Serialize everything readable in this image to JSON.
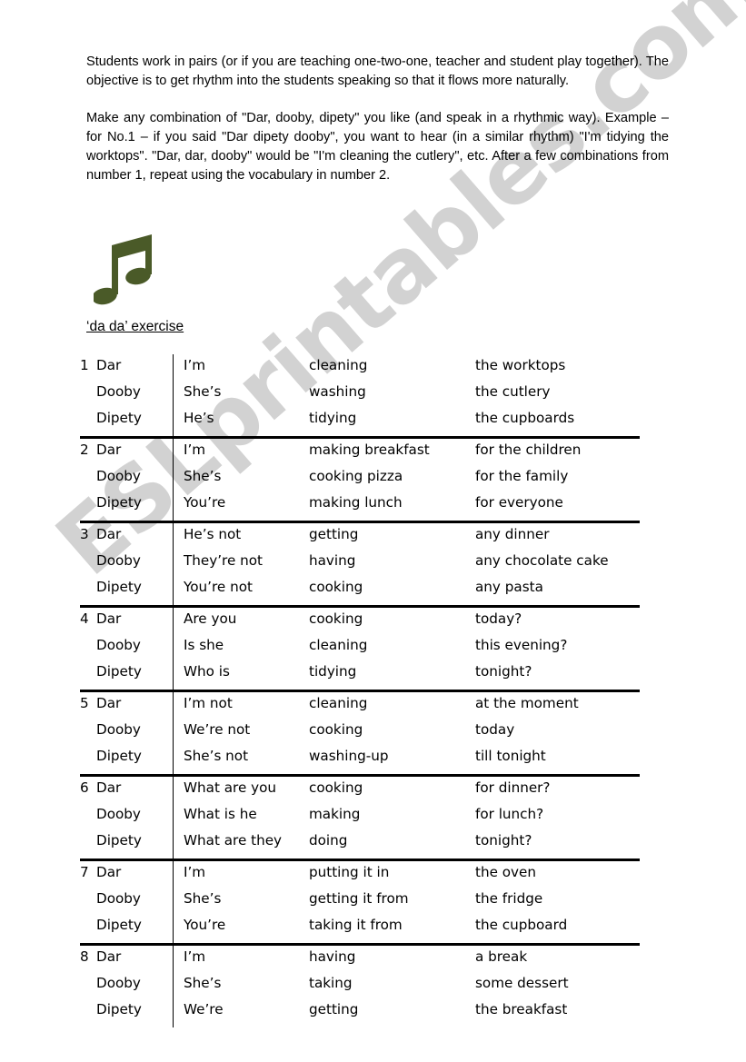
{
  "document": {
    "intro_paragraphs": [
      "Students work in pairs (or if you are teaching one-two-one, teacher and student play together).   The objective is to get rhythm into the students speaking so that it flows more naturally.",
      "Make any combination of \"Dar, dooby, dipety\" you like (and speak in a rhythmic way).  Example – for No.1 – if you said \"Dar dipety dooby\", you want to hear (in a similar rhythm) \"I'm tidying the worktops\".   \"Dar, dar, dooby\" would be \"I'm cleaning the cutlery\", etc.  After a few combinations from number 1, repeat using the vocabulary in number 2."
    ],
    "note_icon_color": "#4a5a28",
    "section_heading": "‘da da’ exercise",
    "watermark_text": "ESLprintables.com",
    "watermark_color": "#d2d2d2"
  },
  "table": {
    "groups": [
      {
        "number": "1",
        "lines": [
          {
            "syllable": "Dar",
            "subject": "I’m",
            "verb": "cleaning",
            "object": "the worktops"
          },
          {
            "syllable": "Dooby",
            "subject": "She’s",
            "verb": "washing",
            "object": "the cutlery"
          },
          {
            "syllable": "Dipety",
            "subject": "He’s",
            "verb": "tidying",
            "object": "the cupboards"
          }
        ]
      },
      {
        "number": "2",
        "lines": [
          {
            "syllable": "Dar",
            "subject": "I’m",
            "verb": "making breakfast",
            "object": "for the children"
          },
          {
            "syllable": "Dooby",
            "subject": "She’s",
            "verb": "cooking pizza",
            "object": "for the family"
          },
          {
            "syllable": "Dipety",
            "subject": "You’re",
            "verb": "making lunch",
            "object": "for everyone"
          }
        ]
      },
      {
        "number": "3",
        "lines": [
          {
            "syllable": "Dar",
            "subject": "He’s not",
            "verb": "getting",
            "object": "any dinner"
          },
          {
            "syllable": "Dooby",
            "subject": "They’re not",
            "verb": "having",
            "object": "any chocolate cake"
          },
          {
            "syllable": "Dipety",
            "subject": "You’re not",
            "verb": "cooking",
            "object": "any pasta"
          }
        ]
      },
      {
        "number": "4",
        "lines": [
          {
            "syllable": "Dar",
            "subject": "Are you",
            "verb": "cooking",
            "object": "today?"
          },
          {
            "syllable": "Dooby",
            "subject": "Is she",
            "verb": "cleaning",
            "object": "this evening?"
          },
          {
            "syllable": "Dipety",
            "subject": "Who is",
            "verb": "tidying",
            "object": "tonight?"
          }
        ]
      },
      {
        "number": "5",
        "lines": [
          {
            "syllable": "Dar",
            "subject": "I’m not",
            "verb": "cleaning",
            "object": "at the moment"
          },
          {
            "syllable": "Dooby",
            "subject": "We’re not",
            "verb": "cooking",
            "object": "today"
          },
          {
            "syllable": "Dipety",
            "subject": "She’s not",
            "verb": "washing-up",
            "object": "till tonight"
          }
        ]
      },
      {
        "number": "6",
        "lines": [
          {
            "syllable": "Dar",
            "subject": "What are you",
            "verb": "cooking",
            "object": "for dinner?"
          },
          {
            "syllable": "Dooby",
            "subject": "What is he",
            "verb": "making",
            "object": "for lunch?"
          },
          {
            "syllable": "Dipety",
            "subject": "What are they",
            "verb": "doing",
            "object": "tonight?"
          }
        ]
      },
      {
        "number": "7",
        "lines": [
          {
            "syllable": "Dar",
            "subject": "I’m",
            "verb": "putting it in",
            "object": "the oven"
          },
          {
            "syllable": "Dooby",
            "subject": "She’s",
            "verb": "getting it from",
            "object": "the fridge"
          },
          {
            "syllable": "Dipety",
            "subject": "You’re",
            "verb": "taking it from",
            "object": "the cupboard"
          }
        ]
      },
      {
        "number": "8",
        "lines": [
          {
            "syllable": "Dar",
            "subject": "I’m",
            "verb": "having",
            "object": "a break"
          },
          {
            "syllable": "Dooby",
            "subject": "She’s",
            "verb": "taking",
            "object": "some dessert"
          },
          {
            "syllable": "Dipety",
            "subject": "We’re",
            "verb": "getting",
            "object": "the breakfast"
          }
        ]
      }
    ]
  }
}
